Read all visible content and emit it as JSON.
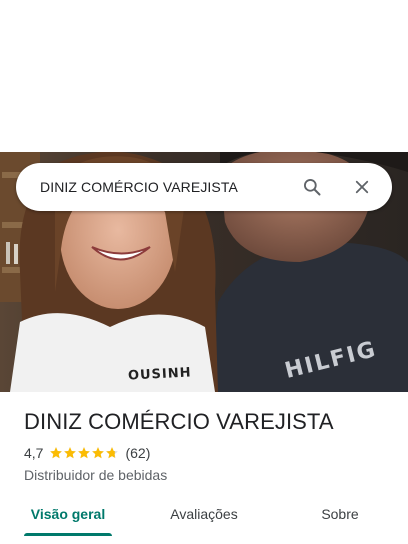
{
  "search": {
    "query": "DINIZ COMÉRCIO VAREJISTA"
  },
  "place": {
    "name": "DINIZ COMÉRCIO VAREJISTA",
    "rating": "4,7",
    "rating_value": 4.7,
    "review_count": "(62)",
    "category": "Distribuidor de bebidas"
  },
  "photo": {
    "shirt_text_left": "OUSINH",
    "shirt_text_right": "HILFIG"
  },
  "tabs": [
    {
      "label": "Visão geral",
      "active": true
    },
    {
      "label": "Avaliações",
      "active": false
    },
    {
      "label": "Sobre",
      "active": false
    }
  ],
  "colors": {
    "accent": "#00796b",
    "star": "#fbbc04"
  },
  "icons": {
    "search": "search-icon",
    "close": "close-icon",
    "star": "star-icon"
  }
}
